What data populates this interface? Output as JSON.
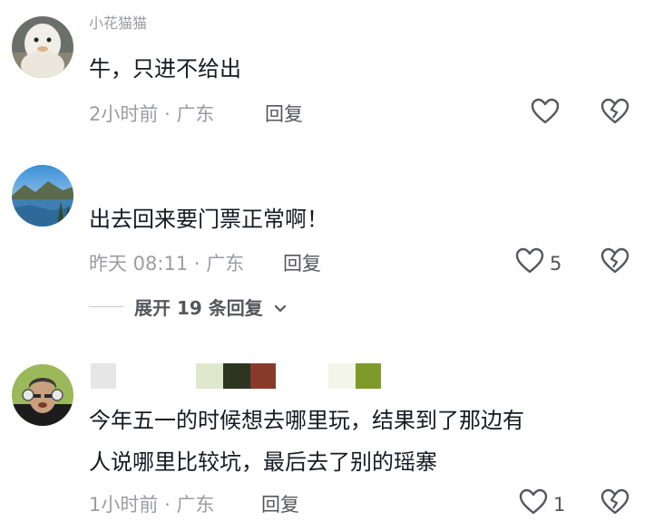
{
  "comments": [
    {
      "username": "小花猫猫",
      "text": "牛，只进不给出",
      "time": "2小时前",
      "location": "广东",
      "reply_label": "回复",
      "likes": ""
    },
    {
      "username": "",
      "text": "出去回来要门票正常啊！",
      "time": "昨天 08:11",
      "location": "广东",
      "reply_label": "回复",
      "likes": "5",
      "expand_label": "展开 19 条回复"
    },
    {
      "username": "",
      "text_lines": [
        "今年五一的时候想去哪里玩，结果到了那边有",
        "人说哪里比较坑，最后去了别的瑶寨"
      ],
      "time": "1小时前",
      "location": "广东",
      "reply_label": "回复",
      "likes": "1"
    }
  ],
  "separator": "·",
  "colors": {
    "text": "#161823",
    "meta": "#9b9ca3",
    "action": "#55565e",
    "censor_blocks": [
      "#e6e6e6",
      "#dfe8cc",
      "#2d3420",
      "#8a3a2a",
      "#f2f5e8",
      "#7f9a2a"
    ]
  },
  "icons": [
    "heart-icon",
    "broken-heart-icon",
    "chevron-down-icon"
  ]
}
